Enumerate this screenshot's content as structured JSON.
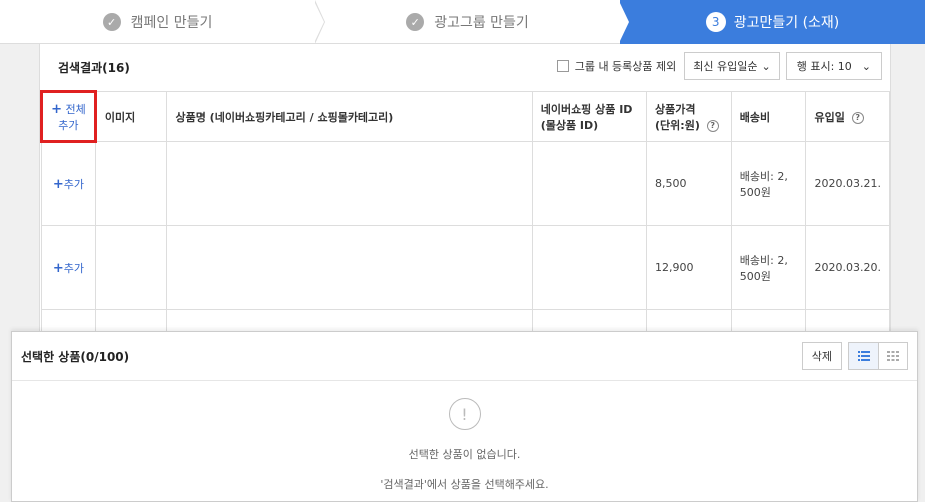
{
  "stepper": {
    "step1": "캠페인 만들기",
    "step2": "광고그룹 만들기",
    "step3_num": "3",
    "step3": "광고만들기 (소재)"
  },
  "result": {
    "title": "검색결과(16)",
    "exclude_label": "그룹 내 등록상품 제외",
    "sort_value": "최신 유입일순",
    "rows_value": "행 표시: 10",
    "columns": {
      "add_all_1": "전체",
      "add_all_2": "추가",
      "image": "이미지",
      "name": "상품명 (네이버쇼핑카테고리 / 쇼핑몰카테고리)",
      "id_1": "네이버쇼핑 상품 ID",
      "id_2": "(몰상품 ID)",
      "price_1": "상품가격",
      "price_2": "(단위:원)",
      "ship": "배송비",
      "date": "유입일"
    },
    "rows": [
      {
        "add": "추가",
        "price": "8,500",
        "ship_1": "배송비: 2,",
        "ship_2": "500원",
        "date": "2020.03.21."
      },
      {
        "add": "추가",
        "price": "12,900",
        "ship_1": "배송비: 2,",
        "ship_2": "500원",
        "date": "2020.03.20."
      }
    ]
  },
  "selected": {
    "title": "선택한 상품(0/100)",
    "delete_label": "삭제",
    "empty_line1": "선택한 상품이 없습니다.",
    "empty_line2": "'검색결과'에서 상품을 선택해주세요."
  },
  "colors": {
    "accent": "#3b7ddd",
    "highlight": "#e02020",
    "link": "#3366cc"
  }
}
